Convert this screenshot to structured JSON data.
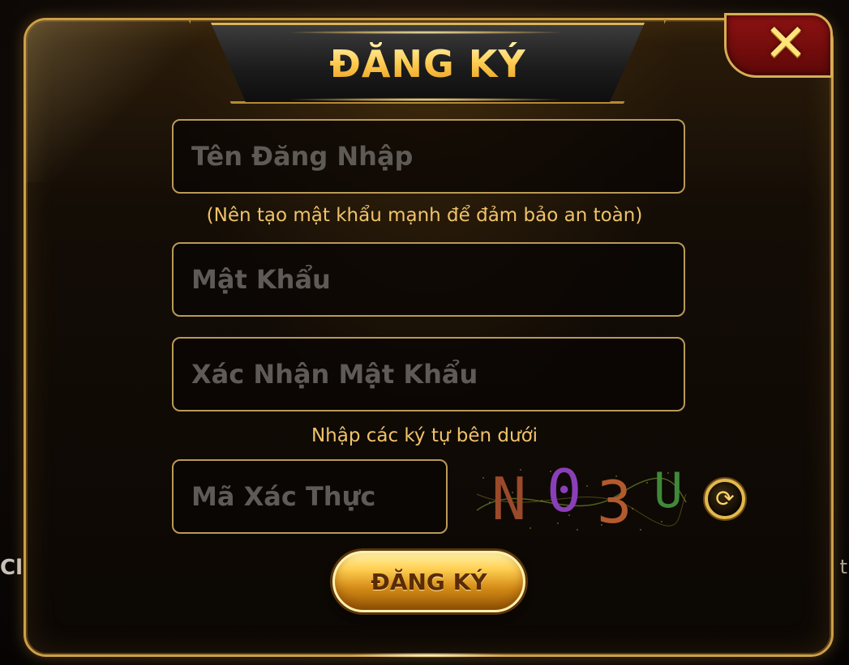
{
  "dialog": {
    "title": "ĐĂNG KÝ",
    "close_icon": "close-x-icon",
    "accent_color": "#ffce55",
    "close_bg_color": "#8e1212"
  },
  "form": {
    "username_placeholder": "Tên Đăng Nhập",
    "password_hint": "(Nên tạo mật khẩu mạnh để đảm bảo an toàn)",
    "password_placeholder": "Mật Khẩu",
    "confirm_password_placeholder": "Xác Nhận Mật Khẩu",
    "captcha_hint": "Nhập các ký tự bên dưới",
    "captcha_placeholder": "Mã Xác Thực",
    "captcha_chars": [
      {
        "char": "N",
        "color": "#9a4a2a"
      },
      {
        "char": "0",
        "color": "#8a3fb8"
      },
      {
        "char": "3",
        "color": "#b25a2e"
      },
      {
        "char": "U",
        "color": "#3f8a3a"
      }
    ],
    "refresh_icon": "refresh-icon",
    "submit_label": "ĐĂNG KÝ"
  },
  "background": {
    "left_edge_text": "Cl",
    "right_edge_text": "t"
  }
}
